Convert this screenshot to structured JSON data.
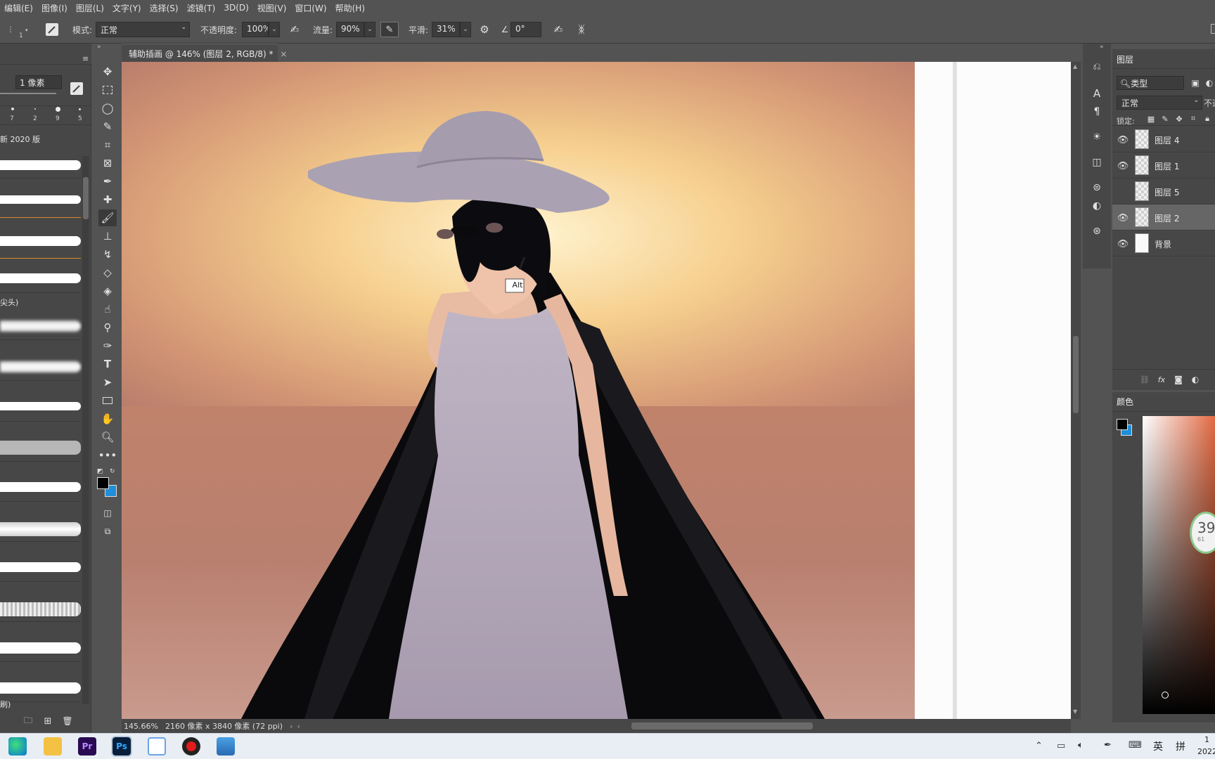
{
  "menu": [
    "编辑(E)",
    "图像(I)",
    "图层(L)",
    "文字(Y)",
    "选择(S)",
    "滤镜(T)",
    "3D(D)",
    "视图(V)",
    "窗口(W)",
    "帮助(H)"
  ],
  "options": {
    "brush_size_num": "1",
    "mode_label": "模式:",
    "mode_value": "正常",
    "opacity_label": "不透明度:",
    "opacity_value": "100%",
    "flow_label": "流量:",
    "flow_value": "90%",
    "smooth_label": "平滑:",
    "smooth_value": "31%",
    "angle_value": "0°"
  },
  "brush_panel": {
    "size_value": "1 像素",
    "preset_sizes": [
      "7",
      "2",
      "9",
      "5"
    ],
    "group_label": "新 2020 版",
    "item_label_1": "尖头)",
    "item_label_2": "刷)"
  },
  "document": {
    "tab_title": "辅助插画 @ 146% (图层 2, RGB/8) *",
    "close_symbol": "×",
    "tooltip": "Alt",
    "status_zoom": "145.66%",
    "status_info": "2160 像素 x 3840 像素 (72 ppi)"
  },
  "layers_panel": {
    "tab_label": "图层",
    "filter_label": "类型",
    "blend_mode": "正常",
    "opacity_label": "不透",
    "lock_label": "锁定:",
    "layers": [
      {
        "name": "图层 4",
        "visible": true,
        "selected": false
      },
      {
        "name": "图层 1",
        "visible": true,
        "selected": false
      },
      {
        "name": "图层 5",
        "visible": false,
        "selected": false
      },
      {
        "name": "图层 2",
        "visible": true,
        "selected": true
      },
      {
        "name": "背景",
        "visible": true,
        "selected": false
      }
    ]
  },
  "color_panel": {
    "tab_label": "颜色",
    "foreground": "#000000",
    "background": "#1e8fd8"
  },
  "widget": {
    "value": "39",
    "sub": "61"
  },
  "taskbar": {
    "ime_lang": "英",
    "ime_mode": "拼",
    "clock_time": "1",
    "clock_date": "2022",
    "apps": [
      "edge-icon",
      "file-explorer-icon",
      "premiere-icon",
      "photoshop-icon",
      "app-icon",
      "recorder-icon",
      "photos-icon"
    ]
  }
}
